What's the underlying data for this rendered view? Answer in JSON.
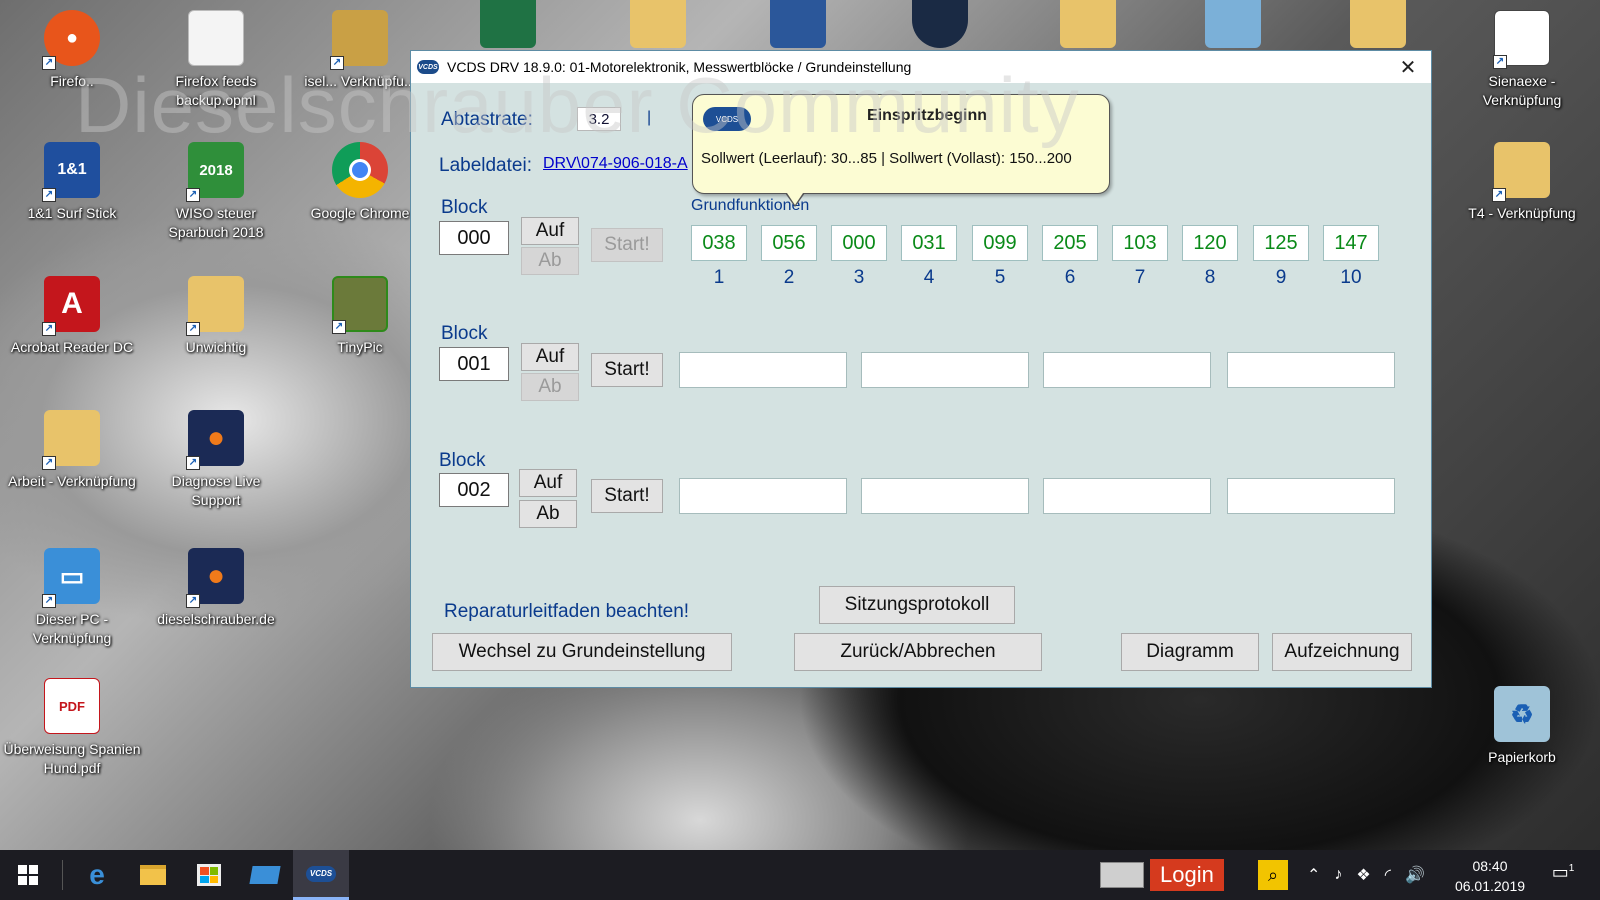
{
  "desktop": {
    "watermark": "Dieselschrauber Community",
    "icons": [
      {
        "label": "Firefo..",
        "color": "#e8551b",
        "glyph": "●"
      },
      {
        "label": "Firefox feeds backup.opml",
        "color": "#f4f4f4",
        "glyph": ""
      },
      {
        "label": "isel... Verknüpfu...",
        "color": "#c9a045",
        "glyph": ""
      },
      {
        "label": "1&1 Surf Stick",
        "color": "#1f4f9e",
        "glyph": "1&1"
      },
      {
        "label": "WISO steuer Sparbuch 2018",
        "color": "#2f8f3a",
        "glyph": "2018"
      },
      {
        "label": "Google Chrome",
        "color": "#dd4b39",
        "glyph": "◉"
      },
      {
        "label": "Acrobat Reader DC",
        "color": "#c4161c",
        "glyph": "A"
      },
      {
        "label": "Unwichtig",
        "color": "#e8c36a",
        "glyph": ""
      },
      {
        "label": "TinyPic",
        "color": "#6b7a3a",
        "glyph": ""
      },
      {
        "label": "Arbeit - Verknüpfung",
        "color": "#e8c36a",
        "glyph": ""
      },
      {
        "label": "Diagnose Live Support",
        "color": "#1b2a55",
        "glyph": "●"
      },
      {
        "label": "Dieser PC - Verknüpfung",
        "color": "#3a8fd8",
        "glyph": "▭"
      },
      {
        "label": "dieselschrauber.de",
        "color": "#1b2a55",
        "glyph": "●"
      },
      {
        "label": "Überweisung Spanien Hund.pdf",
        "color": "#ffffff",
        "glyph": "PDF"
      },
      {
        "label": "Sienaexe - Verknüpfung",
        "color": "#ffffff",
        "glyph": ""
      },
      {
        "label": "T4 - Verknüpfung",
        "color": "#e8c36a",
        "glyph": ""
      },
      {
        "label": "Papierkorb",
        "color": "#9fc3d8",
        "glyph": "♻"
      }
    ]
  },
  "window": {
    "title": "VCDS DRV 18.9.0: 01-Motorelektronik,  Messwertblöcke / Grundeinstellung",
    "app_icon_text": "VCDS",
    "close_glyph": "✕",
    "abtastrate_label": "Abtastrate:",
    "abtastrate_value": "3.2",
    "abtastrate_sep": "|",
    "labeldatei_label": "Labeldatei:",
    "labeldatei_link": "DRV\\074-906-018-A",
    "grundfunktionen_label": "Grundfunktionen",
    "blocks": [
      {
        "label": "Block",
        "number": "000",
        "auf": "Auf",
        "ab": "Ab",
        "start": "Start!"
      },
      {
        "label": "Block",
        "number": "001",
        "auf": "Auf",
        "ab": "Ab",
        "start": "Start!"
      },
      {
        "label": "Block",
        "number": "002",
        "auf": "Auf",
        "ab": "Ab",
        "start": "Start!"
      }
    ],
    "values": [
      "038",
      "056",
      "000",
      "031",
      "099",
      "205",
      "103",
      "120",
      "125",
      "147"
    ],
    "indices": [
      "1",
      "2",
      "3",
      "4",
      "5",
      "6",
      "7",
      "8",
      "9",
      "10"
    ],
    "repair_note": "Reparaturleitfaden beachten!",
    "buttons": {
      "sitzungsprotokoll": "Sitzungsprotokoll",
      "wechsel": "Wechsel zu Grundeinstellung",
      "zurueck": "Zurück/Abbrechen",
      "diagramm": "Diagramm",
      "aufzeichnung": "Aufzeichnung"
    },
    "colors": {
      "value_green": "#0a8a18",
      "label_blue": "#0a3a8c",
      "window_bg": "#d4e2e1"
    }
  },
  "tooltip": {
    "title": "Einspritzbeginn",
    "body": "Sollwert (Leerlauf): 30...85 | Sollwert (Vollast): 150...200",
    "icon_text": "VCDS"
  },
  "taskbar": {
    "login": "Login",
    "time": "08:40",
    "date": "06.01.2019",
    "notification_count": "1"
  }
}
